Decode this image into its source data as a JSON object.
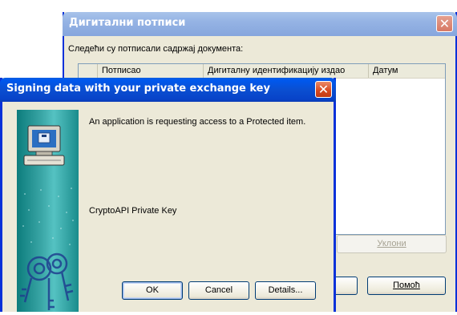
{
  "back_dialog": {
    "title": "Дигитални потписи",
    "label": "Следећи су потписали садржај документа:",
    "columns": [
      "Потписао",
      "Дигиталну идентификацију издао",
      "Датум"
    ],
    "remove_button": "Уклони",
    "help_button": "Помоћ"
  },
  "front_dialog": {
    "title": "Signing data with your private exchange key",
    "message": "An application is requesting access to a Protected item.",
    "item_name": "CryptoAPI Private Key",
    "buttons": {
      "ok": "OK",
      "cancel": "Cancel",
      "details": "Details..."
    }
  },
  "icons": [
    "close-icon",
    "computer-icon",
    "keys-icon"
  ]
}
